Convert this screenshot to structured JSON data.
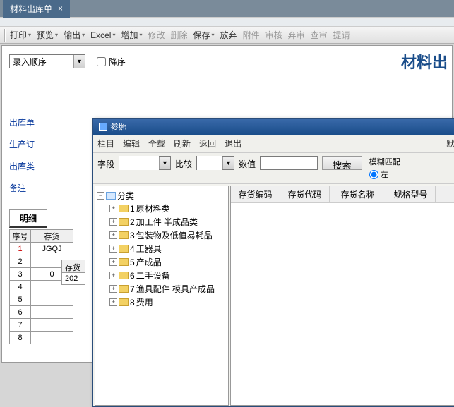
{
  "window": {
    "tab_title": "材料出库单",
    "close_glyph": "×"
  },
  "toolbar": {
    "print": "打印",
    "preview": "预览",
    "output": "输出",
    "excel": "Excel",
    "add": "增加",
    "modify": "修改",
    "delete": "删除",
    "save": "保存",
    "abandon": "放弃",
    "attach": "附件",
    "audit": "审核",
    "unaudit": "弃审",
    "query": "查审",
    "submit": "提请"
  },
  "page": {
    "title": "材料出",
    "entry_order_value": "录入顺序",
    "desc_label": "降序"
  },
  "form_labels": {
    "chukudan": "出库单",
    "shengchanr": "生产订",
    "chukulei": "出库类",
    "beizhu": "备注"
  },
  "detail": {
    "tab": "明细",
    "col_seq": "序号",
    "col_inv": "存货",
    "rows": [
      {
        "seq": "1",
        "val": "JGQJ"
      },
      {
        "seq": "2",
        "val": ""
      },
      {
        "seq": "3",
        "val": "0"
      },
      {
        "seq": "4",
        "val": ""
      },
      {
        "seq": "5",
        "val": ""
      },
      {
        "seq": "6",
        "val": ""
      },
      {
        "seq": "7",
        "val": ""
      },
      {
        "seq": "8",
        "val": ""
      }
    ],
    "sub_header": "存货",
    "sub_val": "202"
  },
  "dialog": {
    "title": "参照",
    "menu": {
      "column": "栏目",
      "edit": "编辑",
      "loadall": "全载",
      "refresh": "刷新",
      "back": "返回",
      "exit": "退出",
      "mo": "默"
    },
    "filter": {
      "field_label": "字段",
      "compare_label": "比较",
      "value_label": "数值",
      "search_btn": "搜索",
      "fuzzy_label": "模糊匹配",
      "left_label": "左"
    },
    "tree": {
      "root": "分类",
      "items": [
        {
          "code": "1",
          "name": "原材料类"
        },
        {
          "code": "2",
          "name": "加工件 半成品类"
        },
        {
          "code": "3",
          "name": "包装物及低值易耗品"
        },
        {
          "code": "4",
          "name": "工器具"
        },
        {
          "code": "5",
          "name": "产成品"
        },
        {
          "code": "6",
          "name": "二手设备"
        },
        {
          "code": "7",
          "name": "渔具配件 模具产成品"
        },
        {
          "code": "8",
          "name": "费用"
        }
      ]
    },
    "grid_headers": {
      "code": "存货编码",
      "alias": "存货代码",
      "name": "存货名称",
      "spec": "规格型号"
    }
  }
}
